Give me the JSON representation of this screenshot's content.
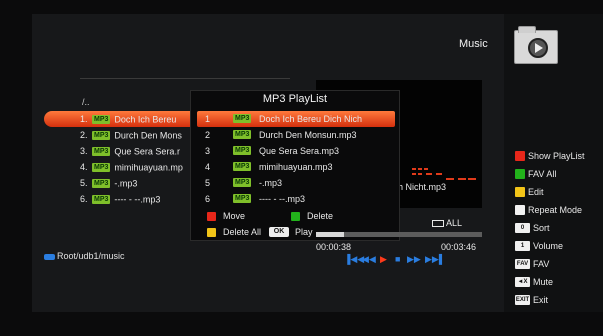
{
  "header": {
    "title": "Music"
  },
  "file_list": {
    "parent": "/..",
    "items": [
      {
        "num": "1.",
        "tag": "MP3",
        "name": "Doch Ich Bereu"
      },
      {
        "num": "2.",
        "tag": "MP3",
        "name": "Durch Den Mons"
      },
      {
        "num": "3.",
        "tag": "MP3",
        "name": "Que Sera Sera.r"
      },
      {
        "num": "4.",
        "tag": "MP3",
        "name": "mimihuayuan.mp"
      },
      {
        "num": "5.",
        "tag": "MP3",
        "name": "-.mp3"
      },
      {
        "num": "6.",
        "tag": "MP3",
        "name": "---- - --.mp3"
      }
    ]
  },
  "playlist_popup": {
    "title": "MP3 PlayList",
    "items": [
      {
        "num": "1",
        "tag": "MP3",
        "name": "Doch Ich Bereu  Dich Nich"
      },
      {
        "num": "2",
        "tag": "MP3",
        "name": "Durch Den Monsun.mp3"
      },
      {
        "num": "3",
        "tag": "MP3",
        "name": "Que Sera Sera.mp3"
      },
      {
        "num": "4",
        "tag": "MP3",
        "name": "mimihuayuan.mp3"
      },
      {
        "num": "5",
        "tag": "MP3",
        "name": "-.mp3"
      },
      {
        "num": "6",
        "tag": "MP3",
        "name": "---- - --.mp3"
      }
    ],
    "legend": {
      "move": "Move",
      "delete": "Delete",
      "delete_all": "Delete All",
      "ok_badge": "OK",
      "play": "Play"
    }
  },
  "player": {
    "filename_partial": "h Nicht.mp3",
    "repeat_mode": "ALL",
    "current_time": "00:00:38",
    "total_time": "00:03:46",
    "progress": 0.17
  },
  "path": "Root/udb1/music",
  "help": {
    "show_playlist": "Show PlayList",
    "fav_all": "FAV All",
    "edit": "Edit",
    "repeat_mode": "Repeat Mode",
    "sort_key": "0",
    "sort": "Sort",
    "volume_key": "1",
    "volume": "Volume",
    "fav_key": "FAV",
    "fav": "FAV",
    "mute_key": "◄X",
    "mute": "Mute",
    "exit_key": "EXIT",
    "exit": "Exit"
  },
  "colors": {
    "red": "#e8271a",
    "green": "#22b21b",
    "yellow": "#f2c418",
    "white": "#f2f2f2",
    "accent_blue": "#2a7de0",
    "selection_orange": "#ff7a3c"
  }
}
